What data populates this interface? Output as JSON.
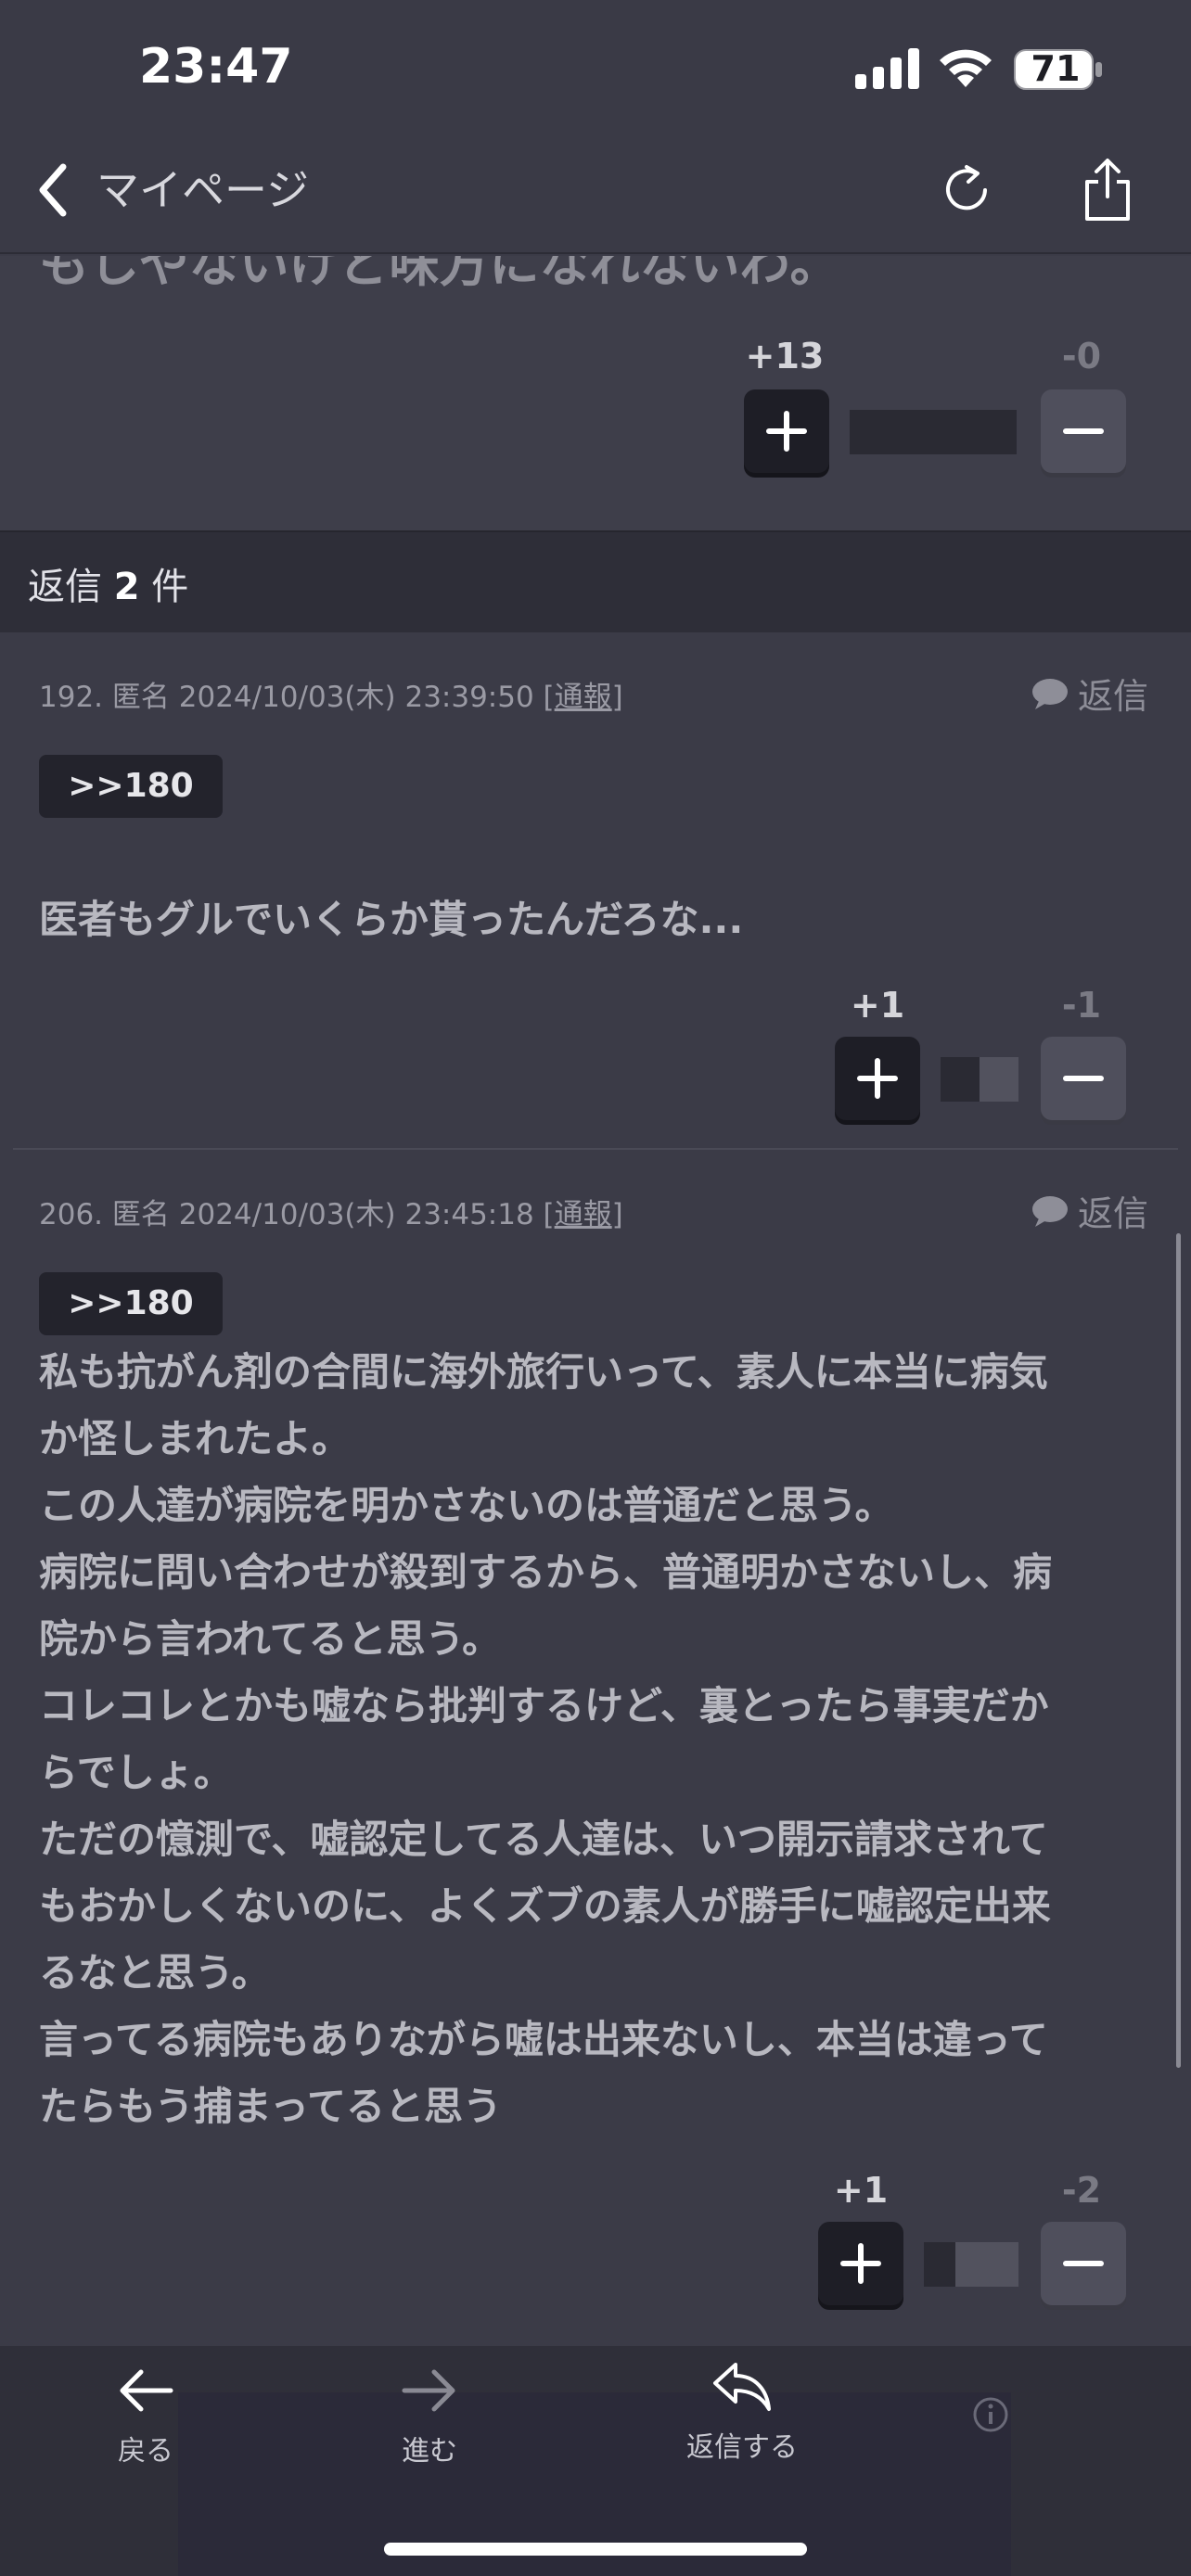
{
  "status_bar": {
    "time": "23:47",
    "battery": "71"
  },
  "nav": {
    "back_label": "マイページ"
  },
  "previous_post": {
    "text_tail": "もしやないけど味方になれないわ。",
    "plus": "+13",
    "minus": "-0",
    "score_share": 1.0
  },
  "replies_header": {
    "prefix": "返信",
    "count": "2",
    "suffix": "件"
  },
  "comments": [
    {
      "number": "192.",
      "author": "匿名",
      "datetime": "2024/10/03(木) 23:39:50",
      "report": "通報",
      "reply_label": "返信",
      "anchor": ">>180",
      "body": "医者もグルでいくらか貰ったんだろな...",
      "plus": "+1",
      "minus": "-1",
      "score_share": 0.5
    },
    {
      "number": "206.",
      "author": "匿名",
      "datetime": "2024/10/03(木) 23:45:18",
      "report": "通報",
      "reply_label": "返信",
      "anchor": ">>180",
      "body": "私も抗がん剤の合間に海外旅行いって、素人に本当に病気\nか怪しまれたよ。\nこの人達が病院を明かさないのは普通だと思う。\n病院に問い合わせが殺到するから、普通明かさないし、病\n院から言われてると思う。\nコレコレとかも嘘なら批判するけど、裏とったら事実だか\nらでしょ。\nただの憶測で、嘘認定してる人達は、いつ開示請求されて\nもおかしくないのに、よくズブの素人が勝手に嘘認定出来\nるなと思う。\n言ってる病院もありながら嘘は出来ないし、本当は違って\nたらもう捕まってると思う",
      "plus": "+1",
      "minus": "-2",
      "score_share": 0.33
    }
  ],
  "bottom_bar": {
    "back": "戻る",
    "forward": "進む",
    "reply": "返信する"
  }
}
